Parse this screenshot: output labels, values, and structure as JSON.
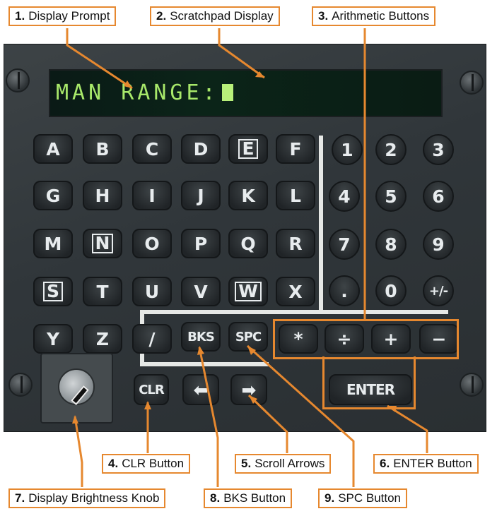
{
  "display_text": "MAN RANGE:",
  "keypad": {
    "letters": [
      [
        "A",
        "B",
        "C",
        "D",
        "E",
        "F"
      ],
      [
        "G",
        "H",
        "I",
        "J",
        "K",
        "L"
      ],
      [
        "M",
        "N",
        "O",
        "P",
        "Q",
        "R"
      ],
      [
        "S",
        "T",
        "U",
        "V",
        "W",
        "X"
      ],
      [
        "Y",
        "Z",
        "/",
        "BKS",
        "SPC"
      ]
    ],
    "numbers": [
      [
        "1",
        "2",
        "3"
      ],
      [
        "4",
        "5",
        "6"
      ],
      [
        "7",
        "8",
        "9"
      ],
      [
        ".",
        "0",
        "+/-"
      ]
    ],
    "arithmetic": [
      "*",
      "÷",
      "+",
      "−"
    ],
    "clr": "CLR",
    "scroll_left": "⬅",
    "scroll_right": "➡",
    "enter": "ENTER"
  },
  "callouts": [
    {
      "num": "1.",
      "label": "Display Prompt"
    },
    {
      "num": "2.",
      "label": "Scratchpad Display"
    },
    {
      "num": "3.",
      "label": "Arithmetic Buttons"
    },
    {
      "num": "4.",
      "label": "CLR Button"
    },
    {
      "num": "5.",
      "label": "Scroll Arrows"
    },
    {
      "num": "6.",
      "label": "ENTER Button"
    },
    {
      "num": "7.",
      "label": "Display Brightness Knob"
    },
    {
      "num": "8.",
      "label": "BKS Button"
    },
    {
      "num": "9.",
      "label": "SPC Button"
    }
  ],
  "colors": {
    "accent": "#e6882f",
    "display_text": "#a8e86a"
  }
}
